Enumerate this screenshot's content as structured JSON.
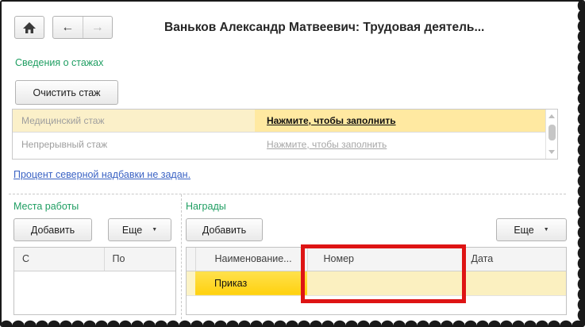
{
  "header": {
    "title": "Ваньков Александр Матвеевич: Трудовая деятель..."
  },
  "icons": {
    "back": "←",
    "forward": "→",
    "dropdown": "▼"
  },
  "stazh": {
    "section_label": "Сведения о стажах",
    "clear_button": "Очистить стаж",
    "rows": [
      {
        "label": "Медицинский стаж",
        "value": "Нажмите, чтобы заполнить",
        "active": true
      },
      {
        "label": "Непрерывный стаж",
        "value": "Нажмите, чтобы заполнить",
        "active": false
      }
    ]
  },
  "north_link": "Процент северной надбавки не задан.",
  "places": {
    "section_label": "Места работы",
    "add_button": "Добавить",
    "more_button": "Еще",
    "columns": [
      "С",
      "По"
    ],
    "rows": []
  },
  "awards": {
    "section_label": "Награды",
    "add_button": "Добавить",
    "more_button": "Еще",
    "columns": [
      "Наименование...",
      "Номер",
      "Дата"
    ],
    "rows": [
      {
        "name": "Приказ",
        "number": "",
        "date": ""
      }
    ]
  },
  "colors": {
    "section_green": "#1f9e62",
    "link_blue": "#3b63c4",
    "highlight_red": "#de1414",
    "current_cell_gold": "#ffd10e",
    "row_pale_yellow": "#fbf0c0"
  }
}
